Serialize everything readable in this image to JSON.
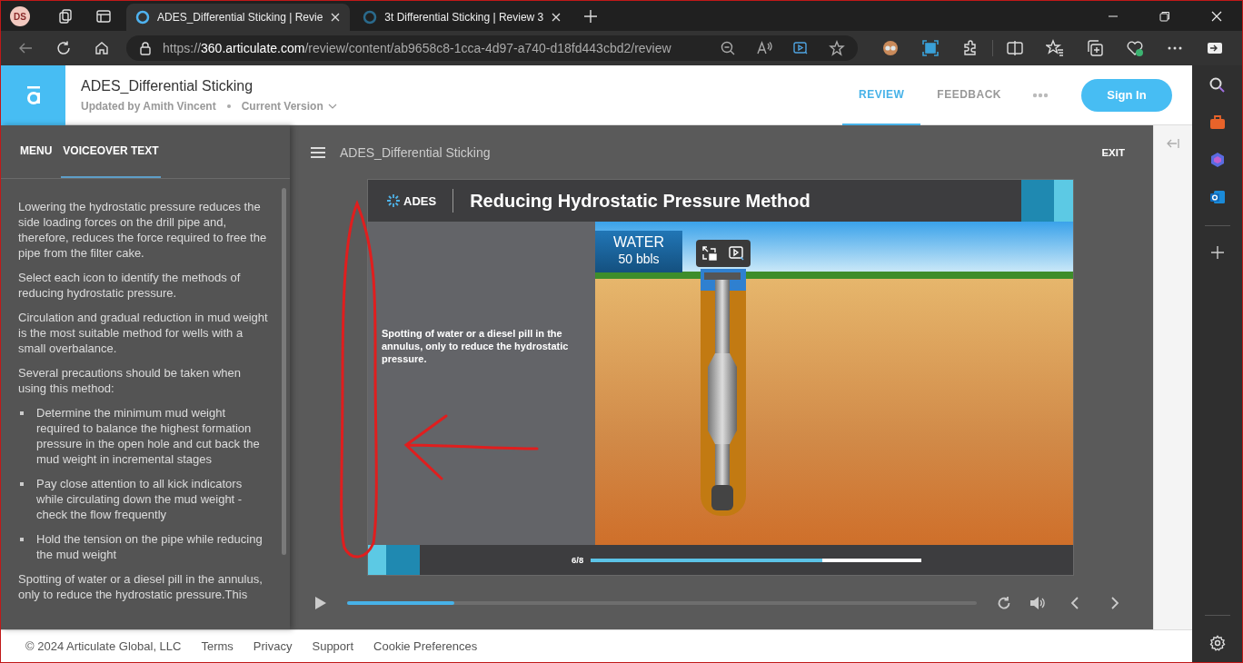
{
  "browser": {
    "profile": "DS",
    "tabs": [
      {
        "title": "ADES_Differential Sticking | Revie",
        "selected": true
      },
      {
        "title": "3t Differential Sticking | Review 3",
        "selected": false
      }
    ],
    "url": {
      "scheme": "https://",
      "host": "360.articulate.com",
      "path": "/review/content/ab9658c8-1cca-4d97-a740-d18fd443cbd2/review"
    }
  },
  "header": {
    "title": "ADES_Differential Sticking",
    "updated_by": "Updated by Amith Vincent",
    "version": "Current Version",
    "nav": [
      {
        "label": "REVIEW",
        "selected": true
      },
      {
        "label": "FEEDBACK",
        "selected": false
      }
    ],
    "sign_in": "Sign In"
  },
  "panel": {
    "tabs": [
      {
        "label": "MENU",
        "selected": false
      },
      {
        "label": "VOICEOVER TEXT",
        "selected": true
      }
    ],
    "voiceover": [
      {
        "kind": "paragraph",
        "text": "Lowering the hydrostatic pressure reduces the side loading forces on the drill pipe and, therefore, reduces the force required to free the pipe from the filter cake."
      },
      {
        "kind": "paragraph",
        "text": "Select each icon to identify the methods of reducing hydrostatic pressure."
      },
      {
        "kind": "paragraph",
        "text": "Circulation and gradual reduction in mud weight is the most suitable method for wells with a small overbalance."
      },
      {
        "kind": "paragraph",
        "text": "Several precautions should be taken when using this method:"
      },
      {
        "kind": "bullets",
        "items": [
          "Determine the minimum mud weight required to balance the highest formation pressure in the open hole and cut back the mud weight in incremental stages",
          "Pay close attention to all kick indicators while circulating down the mud weight - check the flow frequently",
          "Hold the tension on the pipe while reducing the mud weight"
        ]
      },
      {
        "kind": "paragraph",
        "text": "Spotting of water or a diesel pill in the annulus, only to reduce the hydrostatic pressure.This"
      }
    ]
  },
  "player": {
    "title": "ADES_Differential Sticking",
    "exit": "EXIT",
    "seek": {
      "level": 0.17
    }
  },
  "slide": {
    "logo": "ADES",
    "title": "Reducing Hydrostatic Pressure Method",
    "callout": "Spotting of water or a diesel pill in the annulus, only to reduce the hydrostatic pressure.",
    "tank": {
      "label": "WATER",
      "volume": "50 bbls"
    },
    "page": "6/8",
    "progress": {
      "level": 0.7
    }
  },
  "footer": {
    "copyright": "© 2024 Articulate Global, LLC",
    "links": [
      "Terms",
      "Privacy",
      "Support",
      "Cookie Preferences"
    ]
  }
}
